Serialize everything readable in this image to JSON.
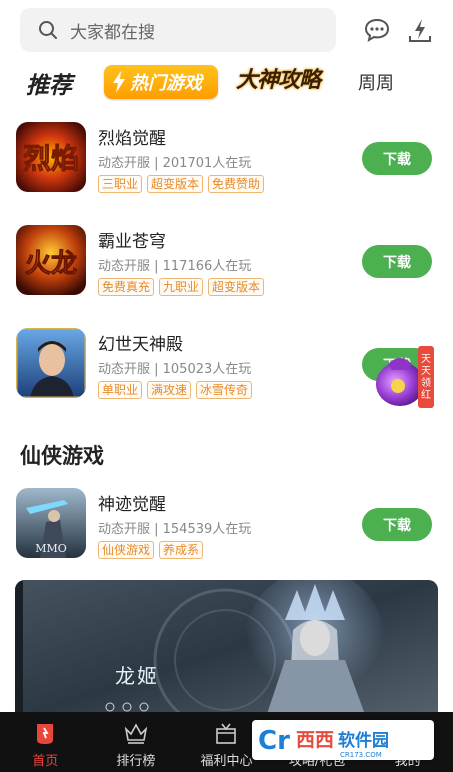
{
  "search": {
    "placeholder": "大家都在搜"
  },
  "top_icons": [
    "chat-bubble-icon",
    "download-icon"
  ],
  "tabs": [
    {
      "label": "推荐",
      "active": true
    },
    {
      "label": "热门游戏"
    },
    {
      "label": "大神攻略"
    },
    {
      "label": "周周"
    }
  ],
  "games": [
    {
      "name": "烈焰觉醒",
      "meta": "动态开服 | 201701人在玩",
      "tags": [
        "三职业",
        "超变版本",
        "免费赞助"
      ],
      "button": "下载",
      "icon_text": "烈焰"
    },
    {
      "name": "霸业苍穹",
      "meta": "动态开服 | 117166人在玩",
      "tags": [
        "免费真充",
        "九职业",
        "超变版本"
      ],
      "button": "下载",
      "icon_text": "火龙"
    },
    {
      "name": "幻世天神殿",
      "meta": "动态开服 | 105023人在玩",
      "tags": [
        "单职业",
        "满攻速",
        "冰雪传奇"
      ],
      "button": "下载",
      "icon_text": ""
    }
  ],
  "section": {
    "title": "仙侠游戏"
  },
  "xianxia_games": [
    {
      "name": "神迹觉醒",
      "meta": "动态开服 | 154539人在玩",
      "tags": [
        "仙侠游戏",
        "养成系"
      ],
      "button": "下载",
      "icon_text": "MMO"
    }
  ],
  "banner": {
    "name": "龙姬"
  },
  "float_badge": {
    "text": "天天领红包"
  },
  "bottom_nav": [
    {
      "label": "首页",
      "icon": "home-icon",
      "active": true
    },
    {
      "label": "排行榜",
      "icon": "crown-icon"
    },
    {
      "label": "福利中心",
      "icon": "gift-icon"
    },
    {
      "label": "攻略/礼包",
      "icon": "book-icon"
    },
    {
      "label": "我的",
      "icon": "user-icon"
    }
  ],
  "watermark": {
    "text": "西西软件园",
    "sub": "CR173.COM"
  },
  "colors": {
    "accent_green": "#4caf50",
    "tag_orange": "#e58b2a",
    "nav_active": "#e8463d",
    "nav_bg": "#111111",
    "hot_tab": "#ffb000"
  }
}
